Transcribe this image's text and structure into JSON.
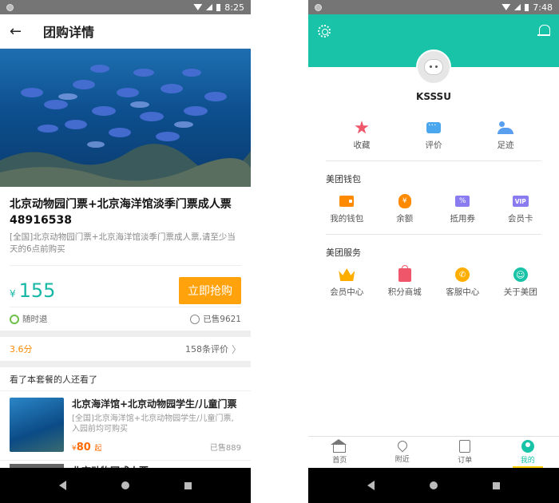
{
  "left": {
    "statusbar": {
      "time": "8:25"
    },
    "appbar": {
      "back_icon": "arrow-left-icon",
      "title": "团购详情"
    },
    "deal": {
      "title": "北京动物园门票+北京海洋馆淡季门票成人票48916538",
      "description": "[全国]北京动物园门票+北京海洋馆淡季门票成人票,请至少当天的6点前购买",
      "price_symbol": "¥",
      "price": "155",
      "buy_label": "立即抢购",
      "refund_label": "随时退",
      "sold_label": "已售9621"
    },
    "rating": {
      "score": "3.6分",
      "reviews_label": "158条评价"
    },
    "recommend": {
      "section_title": "看了本套餐的人还看了",
      "items": [
        {
          "title": "北京海洋馆+北京动物园学生/儿童门票",
          "description": "[全国]北京海洋馆+北京动物园学生/儿童门票,入园前均可购买",
          "price_symbol": "¥",
          "price": "80",
          "price_suffix": "起",
          "sold": "已售889"
        },
        {
          "title": "北京动物园成人票"
        }
      ]
    }
  },
  "right": {
    "statusbar": {
      "time": "7:48"
    },
    "header": {
      "settings_icon": "gear-icon",
      "notify_icon": "bell-icon",
      "accent": "#18c3a8"
    },
    "username": "KSSSU",
    "quick": [
      {
        "label": "收藏",
        "icon": "star-icon"
      },
      {
        "label": "评价",
        "icon": "chat-icon"
      },
      {
        "label": "足迹",
        "icon": "footprint-icon"
      }
    ],
    "wallet": {
      "title": "美团钱包",
      "items": [
        {
          "label": "我的钱包",
          "icon": "wallet-icon"
        },
        {
          "label": "余额",
          "icon": "moneybag-icon",
          "glyph": "¥"
        },
        {
          "label": "抵用券",
          "icon": "coupon-icon",
          "glyph": "%"
        },
        {
          "label": "会员卡",
          "icon": "vip-card-icon",
          "glyph": "VIP"
        }
      ]
    },
    "services": {
      "title": "美团服务",
      "items": [
        {
          "label": "会员中心",
          "icon": "crown-icon"
        },
        {
          "label": "积分商城",
          "icon": "shopping-bag-icon"
        },
        {
          "label": "客服中心",
          "icon": "phone-icon",
          "glyph": "✆"
        },
        {
          "label": "关于美团",
          "icon": "smile-icon",
          "glyph": "☺"
        }
      ]
    },
    "tabs": [
      {
        "label": "首页",
        "icon": "home-icon"
      },
      {
        "label": "附近",
        "icon": "location-pin-icon"
      },
      {
        "label": "订单",
        "icon": "order-icon"
      },
      {
        "label": "我的",
        "icon": "profile-icon",
        "active": true
      }
    ]
  }
}
